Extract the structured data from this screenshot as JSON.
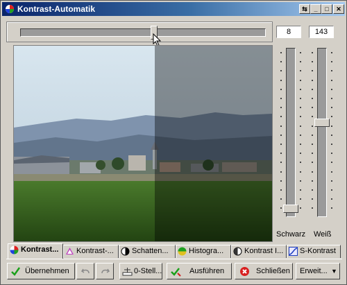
{
  "window": {
    "title": "Kontrast-Automatik"
  },
  "titlebar_buttons": [
    "pin",
    "minimize",
    "maximize",
    "close"
  ],
  "top": {
    "value_left": "8",
    "value_right": "143",
    "slider_level": 0.53
  },
  "sliders": {
    "schwarz": {
      "label": "Schwarz",
      "level": 0.05
    },
    "weiss": {
      "label": "Weiß",
      "level": 0.58
    }
  },
  "tabs": [
    {
      "label": "Kontrast...",
      "icon": "color-wheel-icon",
      "active": true
    },
    {
      "label": "Kontrast-...",
      "icon": "magic-wand-icon",
      "active": false
    },
    {
      "label": "Schatten...",
      "icon": "shadow-icon",
      "active": false
    },
    {
      "label": "Histogra...",
      "icon": "histogram-icon",
      "active": false
    },
    {
      "label": "Kontrast I...",
      "icon": "contrast-icon",
      "active": false
    },
    {
      "label": "S-Kontrast",
      "icon": "s-curve-icon",
      "active": false
    }
  ],
  "buttons": {
    "apply": "Übernehmen",
    "zero": "0-Stell...",
    "run": "Ausführen",
    "close": "Schließen",
    "extended": "Erweit..."
  },
  "colors": {
    "title_start": "#0a246a",
    "title_end": "#a6caf0",
    "face": "#d4d0c8"
  }
}
